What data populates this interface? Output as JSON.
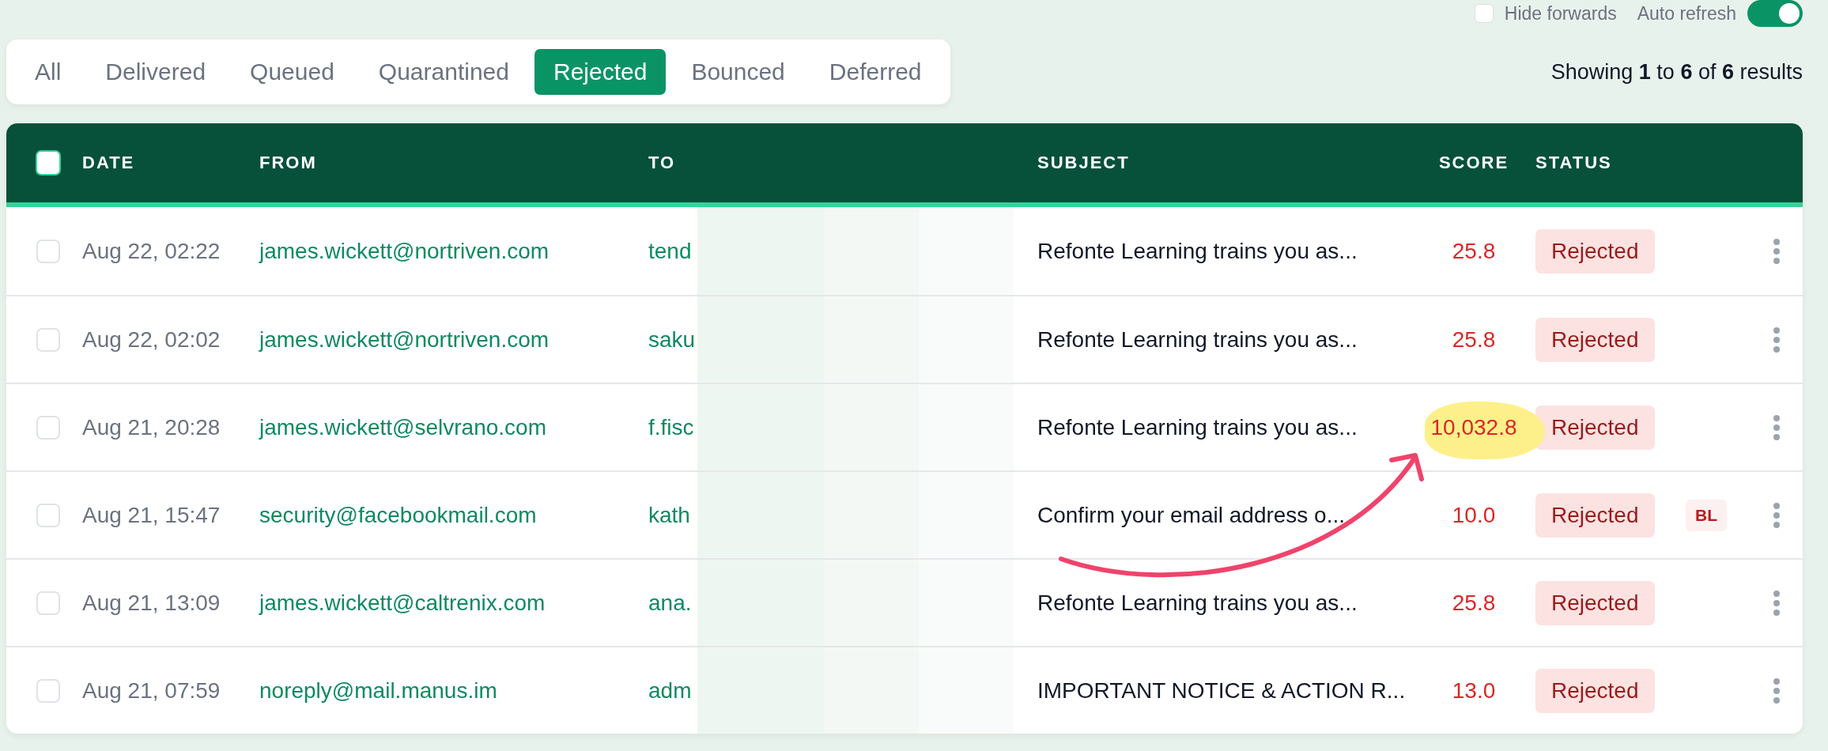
{
  "toolbar": {
    "hide_forwards": {
      "label": "Hide forwards",
      "checked": false
    },
    "auto_refresh": {
      "label": "Auto refresh",
      "on": true
    }
  },
  "tabs": [
    {
      "label": "All",
      "selected": false
    },
    {
      "label": "Delivered",
      "selected": false
    },
    {
      "label": "Queued",
      "selected": false
    },
    {
      "label": "Quarantined",
      "selected": false
    },
    {
      "label": "Rejected",
      "selected": true
    },
    {
      "label": "Bounced",
      "selected": false
    },
    {
      "label": "Deferred",
      "selected": false
    }
  ],
  "results": "Showing **1** to **6** of **6** results",
  "table": {
    "select_all_checked": false,
    "columns": [
      "DATE",
      "FROM",
      "TO",
      "SUBJECT",
      "SCORE",
      "STATUS"
    ],
    "rows": [
      {
        "checked": false,
        "date": "Aug 22, 02:22",
        "from": "james.wickett@nortriven.com",
        "to": "tend",
        "redacted": true,
        "subject": "Refonte Learning trains you as...",
        "score": "25.8",
        "highlighted": false,
        "status": "Rejected",
        "badge": ""
      },
      {
        "checked": false,
        "date": "Aug 22, 02:02",
        "from": "james.wickett@nortriven.com",
        "to": "saku",
        "redacted": true,
        "subject": "Refonte Learning trains you as...",
        "score": "25.8",
        "highlighted": false,
        "status": "Rejected",
        "badge": ""
      },
      {
        "checked": false,
        "date": "Aug 21, 20:28",
        "from": "james.wickett@selvrano.com",
        "to": "f.fisc",
        "redacted": true,
        "subject": "Refonte Learning trains you as...",
        "score": "10,032.8",
        "highlighted": true,
        "status": "Rejected",
        "badge": ""
      },
      {
        "checked": false,
        "date": "Aug 21, 15:47",
        "from": "security@facebookmail.com",
        "to": "kath",
        "redacted": true,
        "subject": "Confirm your email address o...",
        "score": "10.0",
        "highlighted": false,
        "status": "Rejected",
        "badge": "BL"
      },
      {
        "checked": false,
        "date": "Aug 21, 13:09",
        "from": "james.wickett@caltrenix.com",
        "to": "ana.",
        "redacted": true,
        "subject": "Refonte Learning trains you as...",
        "score": "25.8",
        "highlighted": false,
        "status": "Rejected",
        "badge": ""
      },
      {
        "checked": false,
        "date": "Aug 21, 07:59",
        "from": "noreply@mail.manus.im",
        "to": "adm",
        "redacted": true,
        "subject": "IMPORTANT NOTICE & ACTION R...",
        "score": "13.0",
        "highlighted": false,
        "status": "Rejected",
        "badge": ""
      }
    ]
  },
  "arrow": true
}
